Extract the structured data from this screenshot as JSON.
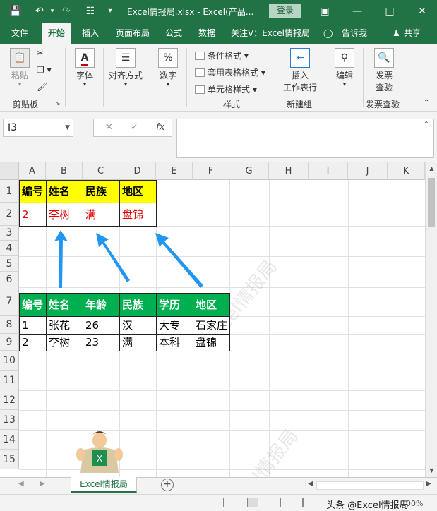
{
  "titlebar": {
    "title": "Excel情报局.xlsx  -  Excel(产品...",
    "login": "登录"
  },
  "menu": {
    "tabs": [
      "文件",
      "开始",
      "插入",
      "页面布局",
      "公式",
      "数据",
      "关注V：Excel情报局",
      "告诉我",
      "共享"
    ],
    "active": "开始"
  },
  "ribbon": {
    "paste": "粘贴",
    "clipboard": "剪贴板",
    "font": "字体",
    "align": "对齐方式",
    "number": "数字",
    "cond_format": "条件格式",
    "table_format": "套用表格格式",
    "cell_style": "单元格样式",
    "styles": "样式",
    "insert_row": "插入\n工作表行",
    "insert_line1": "插入",
    "insert_line2": "工作表行",
    "new_group": "新建组",
    "edit": "编辑",
    "invoice_line1": "发票",
    "invoice_line2": "查验",
    "invoice_group": "发票查验"
  },
  "formula": {
    "namebox": "I3",
    "fx": "fx"
  },
  "grid": {
    "columns": [
      "A",
      "B",
      "C",
      "D",
      "E",
      "F",
      "G",
      "H",
      "I",
      "J",
      "K"
    ],
    "rows": [
      "1",
      "2",
      "3",
      "4",
      "5",
      "6",
      "7",
      "8",
      "9",
      "10",
      "11",
      "12",
      "13",
      "14",
      "15"
    ]
  },
  "top_table": {
    "headers": [
      "编号",
      "姓名",
      "民族",
      "地区"
    ],
    "row": [
      "2",
      "李树",
      "满",
      "盘锦"
    ]
  },
  "bottom_table": {
    "headers": [
      "编号",
      "姓名",
      "年龄",
      "民族",
      "学历",
      "地区"
    ],
    "rows": [
      [
        "1",
        "张花",
        "26",
        "汉",
        "大专",
        "石家庄"
      ],
      [
        "2",
        "李树",
        "23",
        "满",
        "本科",
        "盘锦"
      ]
    ]
  },
  "watermark": "Excel情报局",
  "sheet": {
    "tab": "Excel情报局",
    "add": "+"
  },
  "status": {
    "credit": "头条 @Excel情报局",
    "zoom": "100%"
  },
  "colors": {
    "brand": "#217346",
    "yellow": "#ffff00",
    "green": "#00b050",
    "arrow": "#2196f3",
    "red_text": "#e00000"
  }
}
